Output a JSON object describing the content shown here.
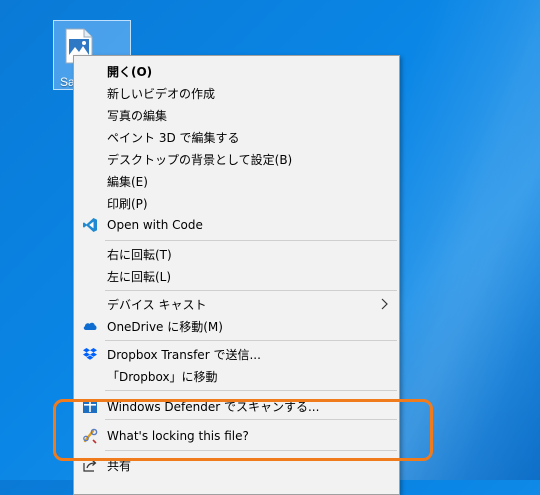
{
  "desktop": {
    "file": {
      "name": "Sa",
      "icon": "image-file-icon"
    }
  },
  "context_menu": {
    "items": [
      {
        "label": "開く(O)",
        "icon": null
      },
      {
        "label": "新しいビデオの作成",
        "icon": null
      },
      {
        "label": "写真の編集",
        "icon": null
      },
      {
        "label": "ペイント 3D で編集する",
        "icon": null
      },
      {
        "label": "デスクトップの背景として設定(B)",
        "icon": null
      },
      {
        "label": "編集(E)",
        "icon": null
      },
      {
        "label": "印刷(P)",
        "icon": null
      },
      {
        "label": "Open with Code",
        "icon": "vscode-icon"
      },
      {
        "label": "右に回転(T)",
        "icon": null
      },
      {
        "label": "左に回転(L)",
        "icon": null
      },
      {
        "label": "デバイス キャスト",
        "icon": null,
        "submenu": true
      },
      {
        "label": "OneDrive に移動(M)",
        "icon": "onedrive-icon"
      },
      {
        "label": "Dropbox Transfer で送信...",
        "icon": "dropbox-icon"
      },
      {
        "label": "「Dropbox」に移動",
        "icon": null
      },
      {
        "label": "Windows Defender でスキャンする...",
        "icon": "defender-icon"
      },
      {
        "label": "What's locking this file?",
        "icon": "whats-locking-icon"
      },
      {
        "label": "共有",
        "icon": "share-icon"
      }
    ]
  },
  "annotation": {
    "highlight_color": "#f07b1d"
  }
}
